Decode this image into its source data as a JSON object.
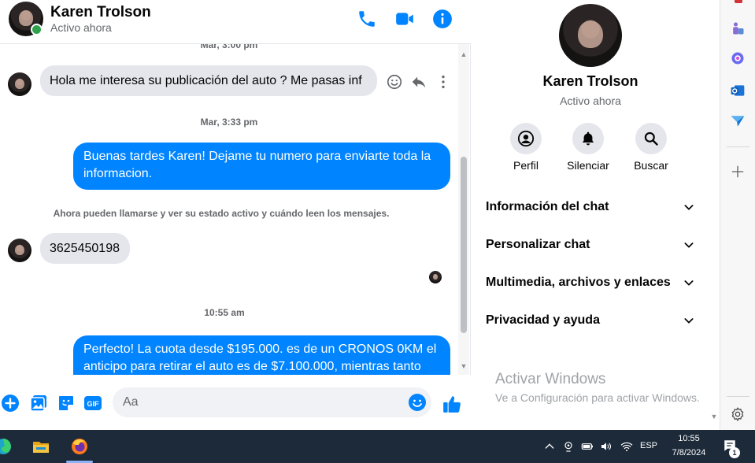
{
  "header": {
    "name": "Karen Trolson",
    "status": "Activo ahora"
  },
  "conversation": {
    "partial_timestamp": "Mar, 3:00 pm",
    "msg1": "Hola me interesa su publicación del auto ? Me pasas inf",
    "timestamp1": "Mar, 3:33 pm",
    "msg2": "Buenas tardes Karen! Dejame tu numero para enviarte toda la informacion.",
    "notice": "Ahora pueden llamarse y ver su estado activo y cuándo leen los mensajes.",
    "msg3": "3625450198",
    "timestamp2": "10:55 am",
    "msg4": "Perfecto! La cuota desde $195.000. es de un CRONOS 0KM el anticipo para retirar el auto es de $7.100.000, mientras tanto"
  },
  "composer": {
    "placeholder": "Aa"
  },
  "info_panel": {
    "name": "Karen Trolson",
    "status": "Activo ahora",
    "actions": {
      "profile": "Perfil",
      "mute": "Silenciar",
      "search": "Buscar"
    },
    "sections": {
      "chat_info": "Información del chat",
      "customize": "Personalizar chat",
      "media": "Multimedia, archivos y enlaces",
      "privacy": "Privacidad y ayuda"
    }
  },
  "watermark": {
    "title": "Activar Windows",
    "subtitle": "Ve a Configuración para activar Windows."
  },
  "taskbar": {
    "language": "ESP",
    "time": "10:55",
    "date": "7/8/2024",
    "notification_count": "1"
  },
  "colors": {
    "accent": "#0084ff",
    "incoming_bubble": "#e4e6eb",
    "online": "#31a24c",
    "taskbar": "#1c2a3a"
  }
}
